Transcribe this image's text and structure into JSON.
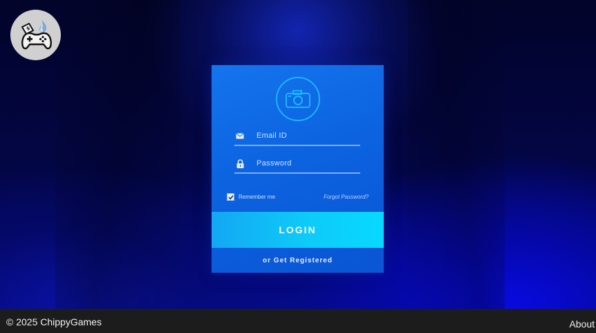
{
  "brand": {
    "logo_icon": "gamepad-flame-icon"
  },
  "login_card": {
    "avatar_icon": "camera-icon",
    "email_icon": "envelope-icon",
    "email_placeholder": "Email ID",
    "password_icon": "lock-icon",
    "password_placeholder": "Password",
    "remember_label": "Remember me",
    "remember_checked": true,
    "forgot_label": "Forgot Password?",
    "login_label": "LOGIN",
    "register_label": "or Get Registered"
  },
  "footer": {
    "copyright": "© 2025 ChippyGames",
    "about_label": "About"
  },
  "colors": {
    "card": "#0c63e0",
    "login_button": "#0ecaf8",
    "footer": "#1c1c1c"
  }
}
